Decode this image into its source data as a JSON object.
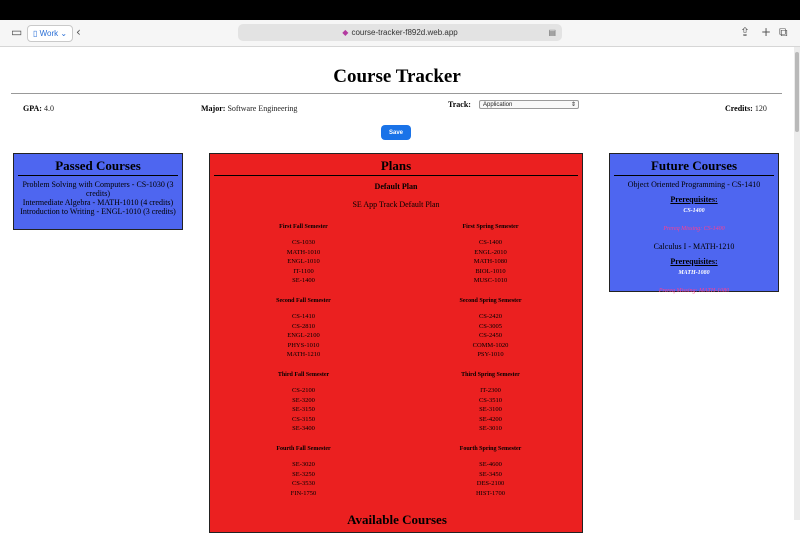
{
  "browser": {
    "tab_group": "Work",
    "url": "course-tracker-f892d.web.app"
  },
  "header": {
    "title": "Course Tracker"
  },
  "info": {
    "gpa_label": "GPA:",
    "gpa_value": "4.0",
    "major_label": "Major:",
    "major_value": "Software Engineering",
    "track_label": "Track:",
    "track_value": "Application",
    "credits_label": "Credits:",
    "credits_value": "120"
  },
  "save_label": "Save",
  "passed": {
    "title": "Passed Courses",
    "items": [
      "Problem Solving with Computers - CS-1030 (3 credits)",
      "Intermediate Algebra - MATH-1010 (4 credits)",
      "Introduction to Writing - ENGL-1010 (3 credits)"
    ]
  },
  "plans": {
    "title": "Plans",
    "plan_name": "Default Plan",
    "plan_desc": "SE App Track Default Plan",
    "semesters": [
      {
        "name": "First Fall Semester",
        "courses": [
          "CS-1030",
          "MATH-1010",
          "ENGL-1010",
          "IT-1100",
          "SE-1400"
        ]
      },
      {
        "name": "First Spring Semester",
        "courses": [
          "CS-1400",
          "ENGL-2010",
          "MATH-1080",
          "BIOL-1010",
          "MUSC-1010"
        ]
      },
      {
        "name": "Second Fall Semester",
        "courses": [
          "CS-1410",
          "CS-2810",
          "ENGL-2100",
          "PHYS-1010",
          "MATH-1210"
        ]
      },
      {
        "name": "Second Spring Semester",
        "courses": [
          "CS-2420",
          "CS-3005",
          "CS-2450",
          "COMM-1020",
          "PSY-1010"
        ]
      },
      {
        "name": "Third Fall Semester",
        "courses": [
          "CS-2100",
          "SE-3200",
          "SE-3150",
          "CS-3150",
          "SE-3400"
        ]
      },
      {
        "name": "Third Spring Semester",
        "courses": [
          "IT-2300",
          "CS-3510",
          "SE-3100",
          "SE-4200",
          "SE-3010"
        ]
      },
      {
        "name": "Fourth Fall Semester",
        "courses": [
          "SE-3020",
          "SE-3250",
          "CS-3530",
          "FIN-1750"
        ]
      },
      {
        "name": "Fourth Spring Semester",
        "courses": [
          "SE-4600",
          "SE-3450",
          "DES-2100",
          "HIST-1700"
        ]
      }
    ]
  },
  "available": {
    "title": "Available Courses"
  },
  "future": {
    "title": "Future Courses",
    "courses": [
      {
        "name": "Object Oriented Programming - CS-1410",
        "prereq_label": "Prerequisites:",
        "prereq": "CS-1400",
        "missing": "Prereq Missing: CS-1400"
      },
      {
        "name": "Calculus I - MATH-1210",
        "prereq_label": "Prerequisites:",
        "prereq": "MATH-1080",
        "missing": "Prereq Missing: MATH-1080"
      }
    ]
  },
  "colors": {
    "panel_blue": "#4e66f0",
    "plans_red": "#eb2020",
    "missing_pink": "#ff3f8e",
    "save_blue": "#1a73e8"
  }
}
